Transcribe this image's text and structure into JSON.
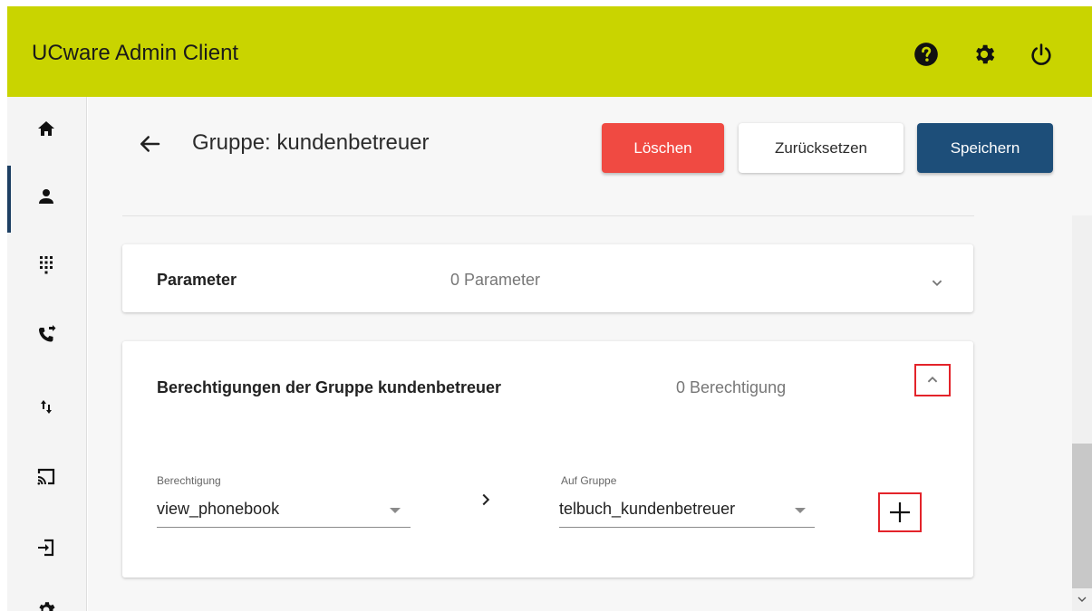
{
  "app": {
    "title": "UCware Admin Client"
  },
  "header_icons": [
    "help-icon",
    "settings-icon",
    "power-icon"
  ],
  "sidebar": {
    "items": [
      {
        "name": "home-icon",
        "active": false
      },
      {
        "name": "user-icon",
        "active": true
      },
      {
        "name": "dialpad-icon",
        "active": false
      },
      {
        "name": "phone-forward-icon",
        "active": false
      },
      {
        "name": "sort-arrows-icon",
        "active": false
      },
      {
        "name": "cast-icon",
        "active": false
      },
      {
        "name": "login-icon",
        "active": false
      },
      {
        "name": "settings-icon",
        "active": false
      }
    ]
  },
  "page": {
    "title": "Gruppe: kundenbetreuer",
    "buttons": {
      "delete": "Löschen",
      "reset": "Zurücksetzen",
      "save": "Speichern"
    }
  },
  "params_card": {
    "label": "Parameter",
    "count": "0 Parameter"
  },
  "perms_card": {
    "label": "Berechtigungen der Gruppe kundenbetreuer",
    "count": "0 Berechtigung",
    "permission_field": {
      "label": "Berechtigung",
      "value": "view_phonebook"
    },
    "group_field": {
      "label": "Auf Gruppe",
      "value": "telbuch_kundenbetreuer"
    }
  },
  "colors": {
    "topbar": "#c9d400",
    "delete": "#f04a42",
    "save": "#1d4e79",
    "highlight": "#e3232a"
  }
}
